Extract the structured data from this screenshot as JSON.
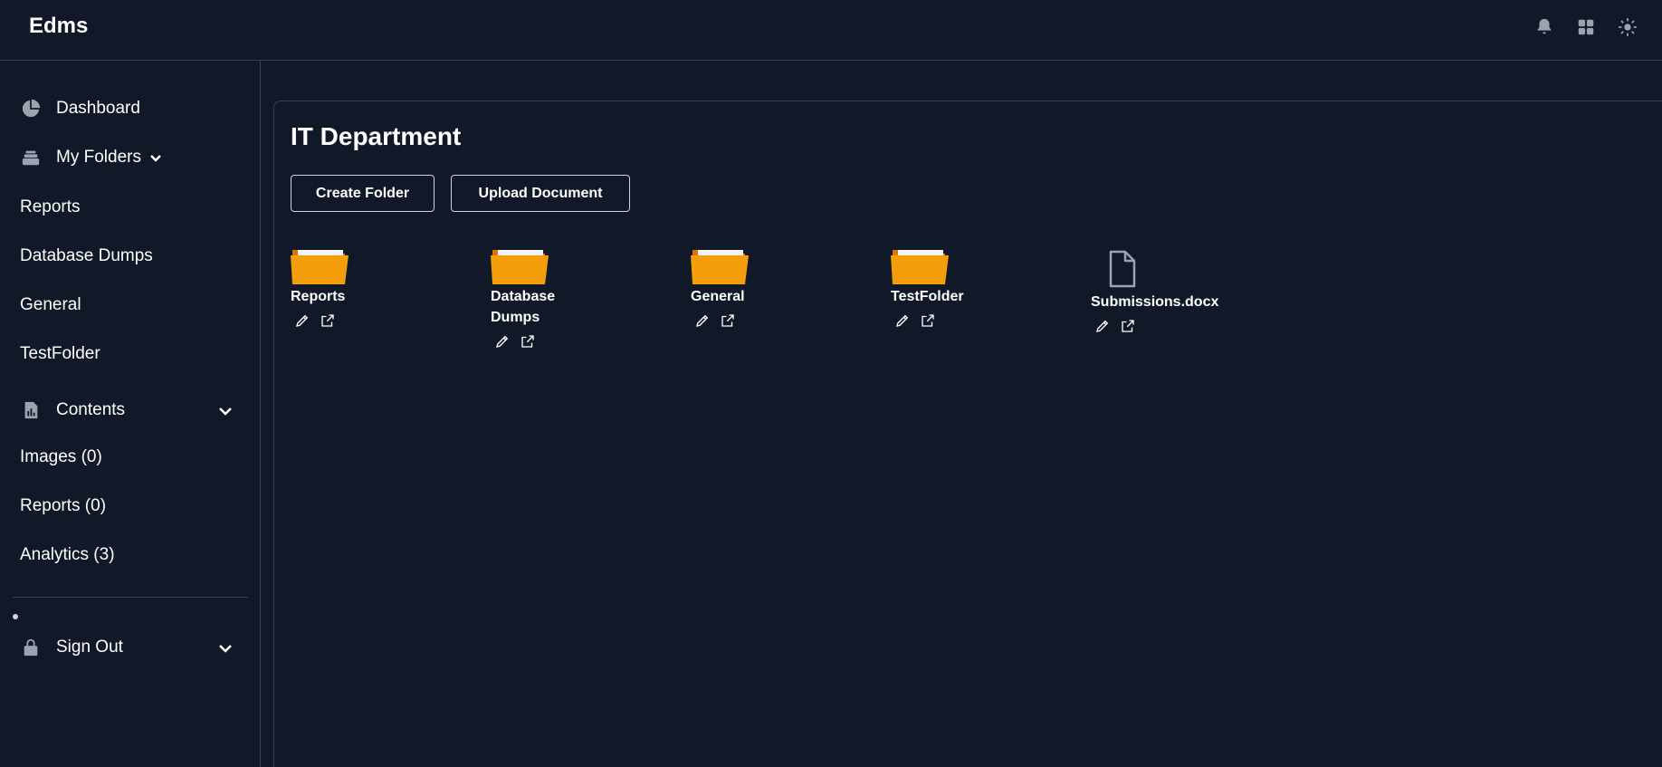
{
  "header": {
    "brand": "Edms",
    "icons": [
      "bell-icon",
      "grid-icon",
      "sun-icon"
    ]
  },
  "sidebar": {
    "dashboard": {
      "label": "Dashboard",
      "icon": "pie-chart-icon"
    },
    "my_folders": {
      "label": "My Folders",
      "icon": "stack-icon",
      "expanded": true
    },
    "folders": [
      "Reports",
      "Database Dumps",
      "General",
      "TestFolder"
    ],
    "contents": {
      "label": "Contents",
      "icon": "file-chart-icon",
      "expanded": true
    },
    "content_items": [
      "Images (0)",
      "Reports (0)",
      "Analytics (3)"
    ],
    "sign_out": {
      "label": "Sign Out",
      "icon": "lock-icon"
    }
  },
  "main": {
    "title": "IT Department",
    "create_folder_label": "Create Folder",
    "upload_document_label": "Upload Document",
    "items": [
      {
        "name": "Reports",
        "type": "folder"
      },
      {
        "name": "Database Dumps",
        "type": "folder"
      },
      {
        "name": "General",
        "type": "folder"
      },
      {
        "name": "TestFolder",
        "type": "folder"
      },
      {
        "name": "Submissions.docx",
        "type": "file"
      }
    ]
  },
  "colors": {
    "background": "#111827",
    "border": "#374151",
    "folder": "#f59e0b",
    "icon_muted": "#9ca3af"
  }
}
